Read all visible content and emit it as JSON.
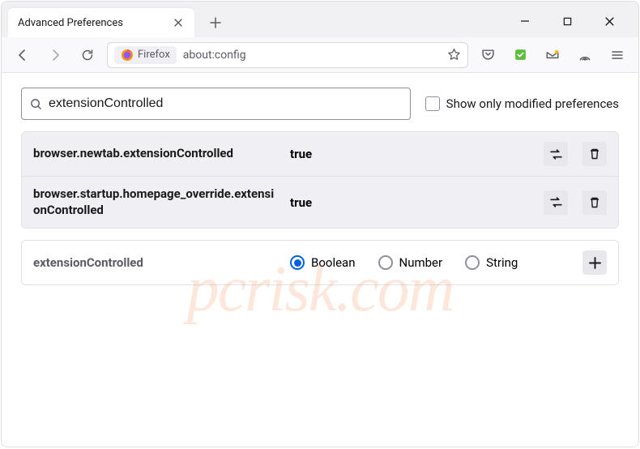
{
  "window": {
    "tab_title": "Advanced Preferences"
  },
  "toolbar": {
    "identity_label": "Firefox",
    "url": "about:config"
  },
  "search": {
    "value": "extensionControlled",
    "checkbox_label": "Show only modified preferences",
    "checked": false
  },
  "prefs": [
    {
      "name": "browser.newtab.extensionControlled",
      "value": "true"
    },
    {
      "name": "browser.startup.homepage_override.extensionControlled",
      "value": "true"
    }
  ],
  "new_pref": {
    "name": "extensionControlled",
    "types": [
      {
        "label": "Boolean",
        "selected": true
      },
      {
        "label": "Number",
        "selected": false
      },
      {
        "label": "String",
        "selected": false
      }
    ]
  },
  "watermark": "pcrisk.com"
}
